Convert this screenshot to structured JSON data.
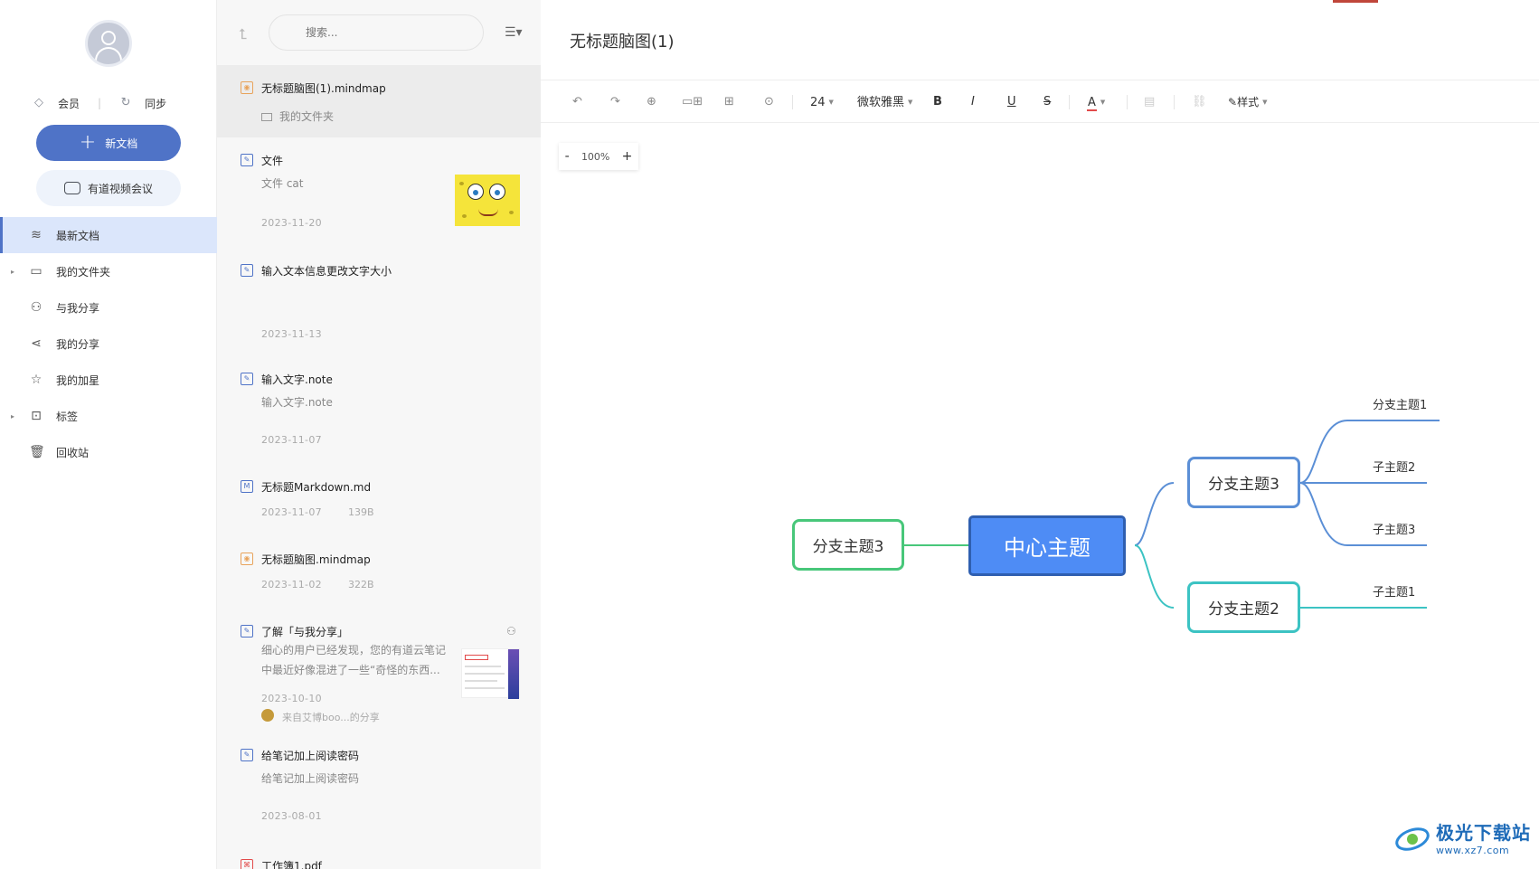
{
  "sidebar": {
    "member_label": "会员",
    "sync_label": "同步",
    "new_doc_label": "新文档",
    "meeting_label": "有道视频会议",
    "items": [
      {
        "label": "最新文档",
        "icon": "layers-icon"
      },
      {
        "label": "我的文件夹",
        "icon": "folder-icon"
      },
      {
        "label": "与我分享",
        "icon": "user-share-icon"
      },
      {
        "label": "我的分享",
        "icon": "share-icon"
      },
      {
        "label": "我的加星",
        "icon": "star-icon"
      },
      {
        "label": "标签",
        "icon": "tag-icon"
      },
      {
        "label": "回收站",
        "icon": "trash-icon"
      }
    ]
  },
  "list": {
    "search_placeholder": "搜索...",
    "docs": [
      {
        "title": "无标题脑图(1).mindmap",
        "folder": "我的文件夹"
      },
      {
        "title": "文件",
        "sub": "文件 cat",
        "date": "2023-11-20"
      },
      {
        "title": "输入文本信息更改文字大小",
        "date": "2023-11-13"
      },
      {
        "title": "输入文字.note",
        "sub": "输入文字.note",
        "date": "2023-11-07"
      },
      {
        "title": "无标题Markdown.md",
        "date": "2023-11-07",
        "size": "139B"
      },
      {
        "title": "无标题脑图.mindmap",
        "date": "2023-11-02",
        "size": "322B"
      },
      {
        "title": "了解「与我分享」",
        "desc": "细心的用户已经发现，您的有道云笔记中最近好像混进了一些“奇怪的东西...",
        "date": "2023-10-10",
        "source": "来自艾博boo...的分享"
      },
      {
        "title": "给笔记加上阅读密码",
        "sub": "给笔记加上阅读密码",
        "date": "2023-08-01"
      },
      {
        "title": "工作簿1.pdf"
      }
    ]
  },
  "editor": {
    "title": "无标题脑图(1)",
    "font_size": "24",
    "font_family": "微软雅黑",
    "bold": "B",
    "italic": "I",
    "underline": "U",
    "strike": "S",
    "font_color": "A",
    "style_label": "样式",
    "zoom_minus": "-",
    "zoom_level": "100%",
    "zoom_plus": "+"
  },
  "mindmap": {
    "center": "中心主题",
    "left_branch": "分支主题3",
    "right_branch_top": "分支主题3",
    "right_branch_bottom": "分支主题2",
    "leaves_top": [
      "分支主题1",
      "子主题2",
      "子主题3"
    ],
    "leaves_bottom": [
      "子主题1"
    ]
  },
  "watermark": {
    "line1": "极光下载站",
    "line2": "www.xz7.com"
  },
  "colors": {
    "accent": "#4f73c7",
    "center_node": "#4e8cf5",
    "branch_green": "#48c77a",
    "branch_blue": "#5b8fd6",
    "branch_cyan": "#3cc3c3"
  }
}
